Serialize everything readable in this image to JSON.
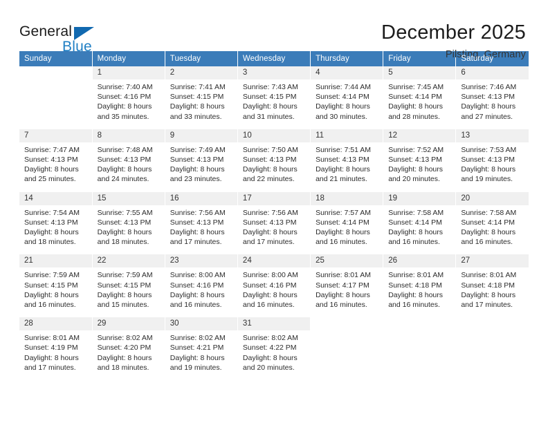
{
  "brand": {
    "name_dark": "General",
    "name_blue": "Blue",
    "accent_blue": "#1f7fc4",
    "triangle_blue": "#1169b0"
  },
  "header": {
    "title": "December 2025",
    "subtitle": "Pilsting, Germany",
    "header_bg": "#3b7cb9",
    "daynum_bg": "#f0f0f0"
  },
  "weekday_headers": [
    "Sunday",
    "Monday",
    "Tuesday",
    "Wednesday",
    "Thursday",
    "Friday",
    "Saturday"
  ],
  "weeks": [
    [
      {
        "day": "",
        "sunrise": "",
        "sunset": "",
        "daylight1": "",
        "daylight2": ""
      },
      {
        "day": "1",
        "sunrise": "Sunrise: 7:40 AM",
        "sunset": "Sunset: 4:16 PM",
        "daylight1": "Daylight: 8 hours",
        "daylight2": "and 35 minutes."
      },
      {
        "day": "2",
        "sunrise": "Sunrise: 7:41 AM",
        "sunset": "Sunset: 4:15 PM",
        "daylight1": "Daylight: 8 hours",
        "daylight2": "and 33 minutes."
      },
      {
        "day": "3",
        "sunrise": "Sunrise: 7:43 AM",
        "sunset": "Sunset: 4:15 PM",
        "daylight1": "Daylight: 8 hours",
        "daylight2": "and 31 minutes."
      },
      {
        "day": "4",
        "sunrise": "Sunrise: 7:44 AM",
        "sunset": "Sunset: 4:14 PM",
        "daylight1": "Daylight: 8 hours",
        "daylight2": "and 30 minutes."
      },
      {
        "day": "5",
        "sunrise": "Sunrise: 7:45 AM",
        "sunset": "Sunset: 4:14 PM",
        "daylight1": "Daylight: 8 hours",
        "daylight2": "and 28 minutes."
      },
      {
        "day": "6",
        "sunrise": "Sunrise: 7:46 AM",
        "sunset": "Sunset: 4:13 PM",
        "daylight1": "Daylight: 8 hours",
        "daylight2": "and 27 minutes."
      }
    ],
    [
      {
        "day": "7",
        "sunrise": "Sunrise: 7:47 AM",
        "sunset": "Sunset: 4:13 PM",
        "daylight1": "Daylight: 8 hours",
        "daylight2": "and 25 minutes."
      },
      {
        "day": "8",
        "sunrise": "Sunrise: 7:48 AM",
        "sunset": "Sunset: 4:13 PM",
        "daylight1": "Daylight: 8 hours",
        "daylight2": "and 24 minutes."
      },
      {
        "day": "9",
        "sunrise": "Sunrise: 7:49 AM",
        "sunset": "Sunset: 4:13 PM",
        "daylight1": "Daylight: 8 hours",
        "daylight2": "and 23 minutes."
      },
      {
        "day": "10",
        "sunrise": "Sunrise: 7:50 AM",
        "sunset": "Sunset: 4:13 PM",
        "daylight1": "Daylight: 8 hours",
        "daylight2": "and 22 minutes."
      },
      {
        "day": "11",
        "sunrise": "Sunrise: 7:51 AM",
        "sunset": "Sunset: 4:13 PM",
        "daylight1": "Daylight: 8 hours",
        "daylight2": "and 21 minutes."
      },
      {
        "day": "12",
        "sunrise": "Sunrise: 7:52 AM",
        "sunset": "Sunset: 4:13 PM",
        "daylight1": "Daylight: 8 hours",
        "daylight2": "and 20 minutes."
      },
      {
        "day": "13",
        "sunrise": "Sunrise: 7:53 AM",
        "sunset": "Sunset: 4:13 PM",
        "daylight1": "Daylight: 8 hours",
        "daylight2": "and 19 minutes."
      }
    ],
    [
      {
        "day": "14",
        "sunrise": "Sunrise: 7:54 AM",
        "sunset": "Sunset: 4:13 PM",
        "daylight1": "Daylight: 8 hours",
        "daylight2": "and 18 minutes."
      },
      {
        "day": "15",
        "sunrise": "Sunrise: 7:55 AM",
        "sunset": "Sunset: 4:13 PM",
        "daylight1": "Daylight: 8 hours",
        "daylight2": "and 18 minutes."
      },
      {
        "day": "16",
        "sunrise": "Sunrise: 7:56 AM",
        "sunset": "Sunset: 4:13 PM",
        "daylight1": "Daylight: 8 hours",
        "daylight2": "and 17 minutes."
      },
      {
        "day": "17",
        "sunrise": "Sunrise: 7:56 AM",
        "sunset": "Sunset: 4:13 PM",
        "daylight1": "Daylight: 8 hours",
        "daylight2": "and 17 minutes."
      },
      {
        "day": "18",
        "sunrise": "Sunrise: 7:57 AM",
        "sunset": "Sunset: 4:14 PM",
        "daylight1": "Daylight: 8 hours",
        "daylight2": "and 16 minutes."
      },
      {
        "day": "19",
        "sunrise": "Sunrise: 7:58 AM",
        "sunset": "Sunset: 4:14 PM",
        "daylight1": "Daylight: 8 hours",
        "daylight2": "and 16 minutes."
      },
      {
        "day": "20",
        "sunrise": "Sunrise: 7:58 AM",
        "sunset": "Sunset: 4:14 PM",
        "daylight1": "Daylight: 8 hours",
        "daylight2": "and 16 minutes."
      }
    ],
    [
      {
        "day": "21",
        "sunrise": "Sunrise: 7:59 AM",
        "sunset": "Sunset: 4:15 PM",
        "daylight1": "Daylight: 8 hours",
        "daylight2": "and 16 minutes."
      },
      {
        "day": "22",
        "sunrise": "Sunrise: 7:59 AM",
        "sunset": "Sunset: 4:15 PM",
        "daylight1": "Daylight: 8 hours",
        "daylight2": "and 15 minutes."
      },
      {
        "day": "23",
        "sunrise": "Sunrise: 8:00 AM",
        "sunset": "Sunset: 4:16 PM",
        "daylight1": "Daylight: 8 hours",
        "daylight2": "and 16 minutes."
      },
      {
        "day": "24",
        "sunrise": "Sunrise: 8:00 AM",
        "sunset": "Sunset: 4:16 PM",
        "daylight1": "Daylight: 8 hours",
        "daylight2": "and 16 minutes."
      },
      {
        "day": "25",
        "sunrise": "Sunrise: 8:01 AM",
        "sunset": "Sunset: 4:17 PM",
        "daylight1": "Daylight: 8 hours",
        "daylight2": "and 16 minutes."
      },
      {
        "day": "26",
        "sunrise": "Sunrise: 8:01 AM",
        "sunset": "Sunset: 4:18 PM",
        "daylight1": "Daylight: 8 hours",
        "daylight2": "and 16 minutes."
      },
      {
        "day": "27",
        "sunrise": "Sunrise: 8:01 AM",
        "sunset": "Sunset: 4:18 PM",
        "daylight1": "Daylight: 8 hours",
        "daylight2": "and 17 minutes."
      }
    ],
    [
      {
        "day": "28",
        "sunrise": "Sunrise: 8:01 AM",
        "sunset": "Sunset: 4:19 PM",
        "daylight1": "Daylight: 8 hours",
        "daylight2": "and 17 minutes."
      },
      {
        "day": "29",
        "sunrise": "Sunrise: 8:02 AM",
        "sunset": "Sunset: 4:20 PM",
        "daylight1": "Daylight: 8 hours",
        "daylight2": "and 18 minutes."
      },
      {
        "day": "30",
        "sunrise": "Sunrise: 8:02 AM",
        "sunset": "Sunset: 4:21 PM",
        "daylight1": "Daylight: 8 hours",
        "daylight2": "and 19 minutes."
      },
      {
        "day": "31",
        "sunrise": "Sunrise: 8:02 AM",
        "sunset": "Sunset: 4:22 PM",
        "daylight1": "Daylight: 8 hours",
        "daylight2": "and 20 minutes."
      },
      {
        "day": "",
        "sunrise": "",
        "sunset": "",
        "daylight1": "",
        "daylight2": ""
      },
      {
        "day": "",
        "sunrise": "",
        "sunset": "",
        "daylight1": "",
        "daylight2": ""
      },
      {
        "day": "",
        "sunrise": "",
        "sunset": "",
        "daylight1": "",
        "daylight2": ""
      }
    ]
  ]
}
